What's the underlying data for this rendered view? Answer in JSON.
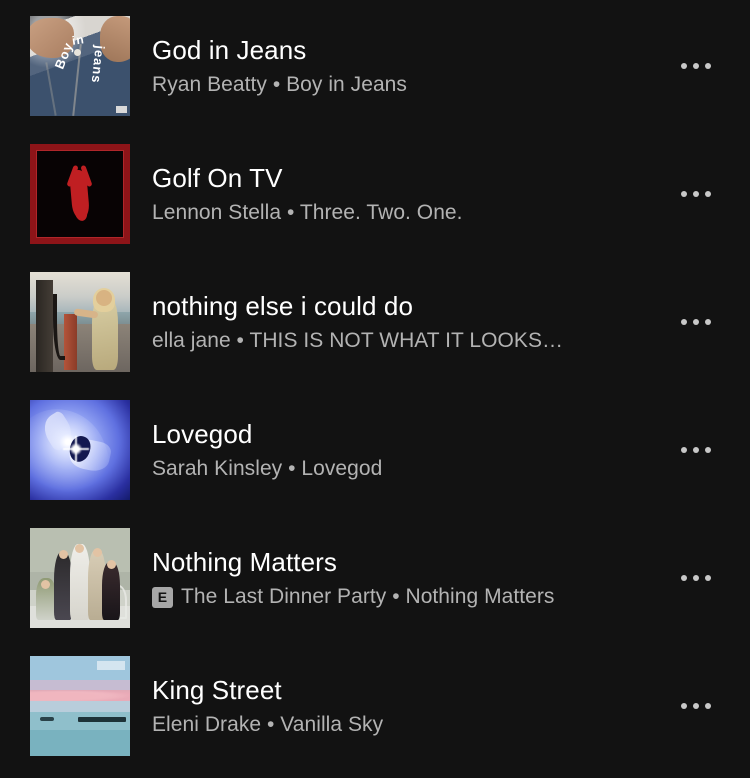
{
  "screen": {
    "name": "track-list",
    "background_color": "#121212",
    "title_color": "#ffffff",
    "subtitle_color": "#b3b3b3",
    "separator": "•"
  },
  "tracks": [
    {
      "title": "God in Jeans",
      "artist": "Ryan Beatty",
      "album": "Boy in Jeans",
      "subtitle": "Ryan Beatty • Boy in Jeans",
      "explicit": false,
      "explicit_label": "E",
      "art_name": "album-art-god-in-jeans",
      "art_text_1": "Boy",
      "art_text_2": "in",
      "art_text_3": "jeans",
      "more_label": "More options"
    },
    {
      "title": "Golf On TV",
      "artist": "Lennon Stella",
      "album": "Three. Two. One.",
      "subtitle": "Lennon Stella • Three. Two. One.",
      "explicit": false,
      "explicit_label": "E",
      "art_name": "album-art-golf-on-tv",
      "more_label": "More options"
    },
    {
      "title": "nothing else i could do",
      "artist": "ella jane",
      "album": "THIS IS NOT WHAT IT LOOKS…",
      "subtitle": "ella jane • THIS IS NOT WHAT IT LOOKS…",
      "explicit": false,
      "explicit_label": "E",
      "art_name": "album-art-nothing-else-i-could-do",
      "more_label": "More options"
    },
    {
      "title": "Lovegod",
      "artist": "Sarah Kinsley",
      "album": "Lovegod",
      "subtitle": "Sarah Kinsley • Lovegod",
      "explicit": false,
      "explicit_label": "E",
      "art_name": "album-art-lovegod",
      "more_label": "More options"
    },
    {
      "title": "Nothing Matters",
      "artist": "The Last Dinner Party",
      "album": "Nothing Matters",
      "subtitle": "The Last Dinner Party • Nothing Matters",
      "explicit": true,
      "explicit_label": "E",
      "art_name": "album-art-nothing-matters",
      "more_label": "More options"
    },
    {
      "title": "King Street",
      "artist": "Eleni Drake",
      "album": "Vanilla Sky",
      "subtitle": "Eleni Drake • Vanilla Sky",
      "explicit": false,
      "explicit_label": "E",
      "art_name": "album-art-king-street",
      "more_label": "More options"
    }
  ]
}
